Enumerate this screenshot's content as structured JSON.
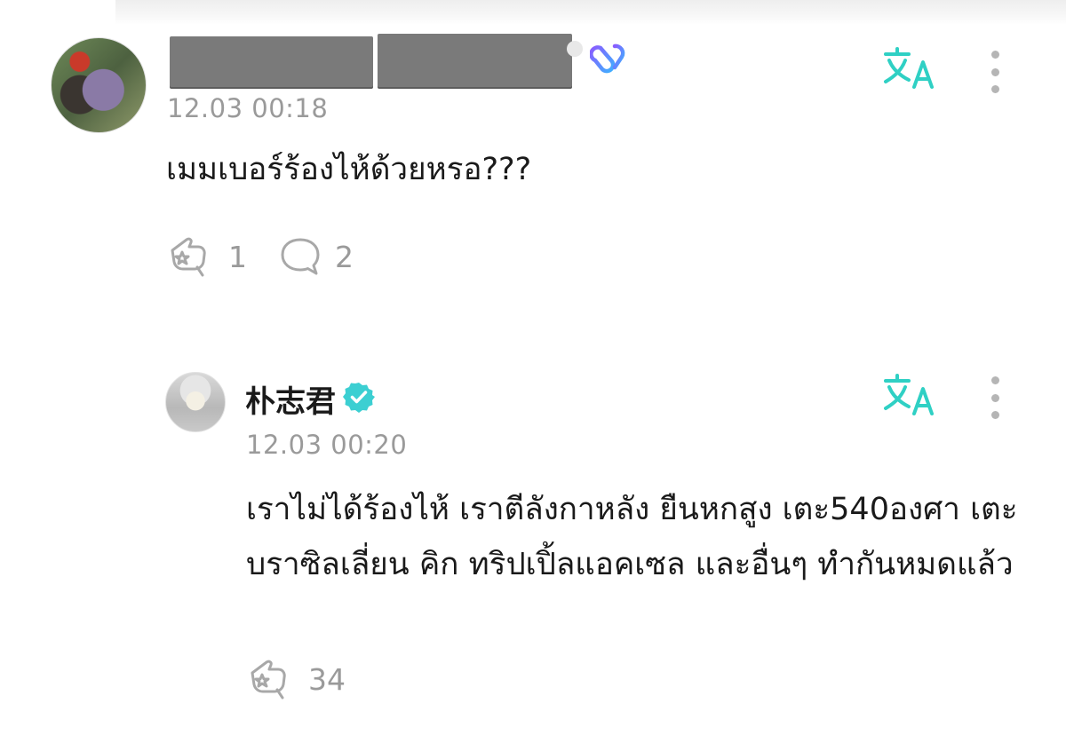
{
  "comments": [
    {
      "timestamp": "12.03 00:18",
      "text": "เมมเบอร์ร้องไห้ด้วยหรอ???",
      "likes": "1",
      "replies": "2"
    },
    {
      "username": "朴志君",
      "timestamp": "12.03 00:20",
      "text": "เราไม่ได้ร้องไห้ เราตีลังกาหลัง ยืนหกสูง เตะ540องศา เตะบราซิลเลี่ยน คิก ทริปเปิ้ลแอคเซล และอื่นๆ ทำกันหมดแล้ว",
      "likes": "34"
    }
  ],
  "icons": {
    "translate": "translate-icon",
    "more": "kebab-menu-icon",
    "like": "hand-star-icon",
    "reply": "speech-bubble-icon",
    "verified": "verified-check-icon",
    "membership": "link-badge-icon"
  },
  "colors": {
    "accent": "#2fd0c4",
    "timestamp": "#9a9a9a",
    "icon_gray": "#b5b5b5",
    "badge_gradient": [
      "#7b6cff",
      "#4fb8ff"
    ]
  }
}
